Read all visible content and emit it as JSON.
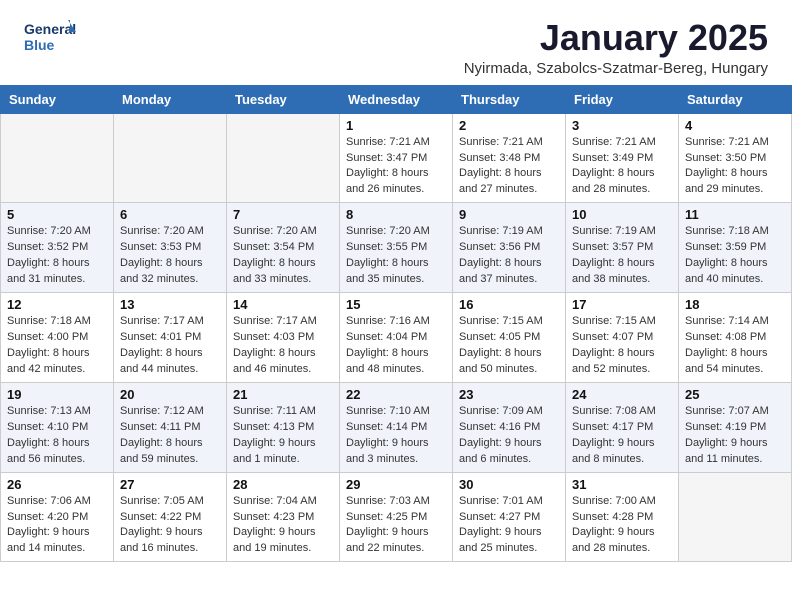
{
  "header": {
    "logo_line1": "General",
    "logo_line2": "Blue",
    "month_title": "January 2025",
    "subtitle": "Nyirmada, Szabolcs-Szatmar-Bereg, Hungary"
  },
  "weekdays": [
    "Sunday",
    "Monday",
    "Tuesday",
    "Wednesday",
    "Thursday",
    "Friday",
    "Saturday"
  ],
  "weeks": [
    [
      {
        "day": "",
        "info": ""
      },
      {
        "day": "",
        "info": ""
      },
      {
        "day": "",
        "info": ""
      },
      {
        "day": "1",
        "info": "Sunrise: 7:21 AM\nSunset: 3:47 PM\nDaylight: 8 hours\nand 26 minutes."
      },
      {
        "day": "2",
        "info": "Sunrise: 7:21 AM\nSunset: 3:48 PM\nDaylight: 8 hours\nand 27 minutes."
      },
      {
        "day": "3",
        "info": "Sunrise: 7:21 AM\nSunset: 3:49 PM\nDaylight: 8 hours\nand 28 minutes."
      },
      {
        "day": "4",
        "info": "Sunrise: 7:21 AM\nSunset: 3:50 PM\nDaylight: 8 hours\nand 29 minutes."
      }
    ],
    [
      {
        "day": "5",
        "info": "Sunrise: 7:20 AM\nSunset: 3:52 PM\nDaylight: 8 hours\nand 31 minutes."
      },
      {
        "day": "6",
        "info": "Sunrise: 7:20 AM\nSunset: 3:53 PM\nDaylight: 8 hours\nand 32 minutes."
      },
      {
        "day": "7",
        "info": "Sunrise: 7:20 AM\nSunset: 3:54 PM\nDaylight: 8 hours\nand 33 minutes."
      },
      {
        "day": "8",
        "info": "Sunrise: 7:20 AM\nSunset: 3:55 PM\nDaylight: 8 hours\nand 35 minutes."
      },
      {
        "day": "9",
        "info": "Sunrise: 7:19 AM\nSunset: 3:56 PM\nDaylight: 8 hours\nand 37 minutes."
      },
      {
        "day": "10",
        "info": "Sunrise: 7:19 AM\nSunset: 3:57 PM\nDaylight: 8 hours\nand 38 minutes."
      },
      {
        "day": "11",
        "info": "Sunrise: 7:18 AM\nSunset: 3:59 PM\nDaylight: 8 hours\nand 40 minutes."
      }
    ],
    [
      {
        "day": "12",
        "info": "Sunrise: 7:18 AM\nSunset: 4:00 PM\nDaylight: 8 hours\nand 42 minutes."
      },
      {
        "day": "13",
        "info": "Sunrise: 7:17 AM\nSunset: 4:01 PM\nDaylight: 8 hours\nand 44 minutes."
      },
      {
        "day": "14",
        "info": "Sunrise: 7:17 AM\nSunset: 4:03 PM\nDaylight: 8 hours\nand 46 minutes."
      },
      {
        "day": "15",
        "info": "Sunrise: 7:16 AM\nSunset: 4:04 PM\nDaylight: 8 hours\nand 48 minutes."
      },
      {
        "day": "16",
        "info": "Sunrise: 7:15 AM\nSunset: 4:05 PM\nDaylight: 8 hours\nand 50 minutes."
      },
      {
        "day": "17",
        "info": "Sunrise: 7:15 AM\nSunset: 4:07 PM\nDaylight: 8 hours\nand 52 minutes."
      },
      {
        "day": "18",
        "info": "Sunrise: 7:14 AM\nSunset: 4:08 PM\nDaylight: 8 hours\nand 54 minutes."
      }
    ],
    [
      {
        "day": "19",
        "info": "Sunrise: 7:13 AM\nSunset: 4:10 PM\nDaylight: 8 hours\nand 56 minutes."
      },
      {
        "day": "20",
        "info": "Sunrise: 7:12 AM\nSunset: 4:11 PM\nDaylight: 8 hours\nand 59 minutes."
      },
      {
        "day": "21",
        "info": "Sunrise: 7:11 AM\nSunset: 4:13 PM\nDaylight: 9 hours\nand 1 minute."
      },
      {
        "day": "22",
        "info": "Sunrise: 7:10 AM\nSunset: 4:14 PM\nDaylight: 9 hours\nand 3 minutes."
      },
      {
        "day": "23",
        "info": "Sunrise: 7:09 AM\nSunset: 4:16 PM\nDaylight: 9 hours\nand 6 minutes."
      },
      {
        "day": "24",
        "info": "Sunrise: 7:08 AM\nSunset: 4:17 PM\nDaylight: 9 hours\nand 8 minutes."
      },
      {
        "day": "25",
        "info": "Sunrise: 7:07 AM\nSunset: 4:19 PM\nDaylight: 9 hours\nand 11 minutes."
      }
    ],
    [
      {
        "day": "26",
        "info": "Sunrise: 7:06 AM\nSunset: 4:20 PM\nDaylight: 9 hours\nand 14 minutes."
      },
      {
        "day": "27",
        "info": "Sunrise: 7:05 AM\nSunset: 4:22 PM\nDaylight: 9 hours\nand 16 minutes."
      },
      {
        "day": "28",
        "info": "Sunrise: 7:04 AM\nSunset: 4:23 PM\nDaylight: 9 hours\nand 19 minutes."
      },
      {
        "day": "29",
        "info": "Sunrise: 7:03 AM\nSunset: 4:25 PM\nDaylight: 9 hours\nand 22 minutes."
      },
      {
        "day": "30",
        "info": "Sunrise: 7:01 AM\nSunset: 4:27 PM\nDaylight: 9 hours\nand 25 minutes."
      },
      {
        "day": "31",
        "info": "Sunrise: 7:00 AM\nSunset: 4:28 PM\nDaylight: 9 hours\nand 28 minutes."
      },
      {
        "day": "",
        "info": ""
      }
    ]
  ]
}
